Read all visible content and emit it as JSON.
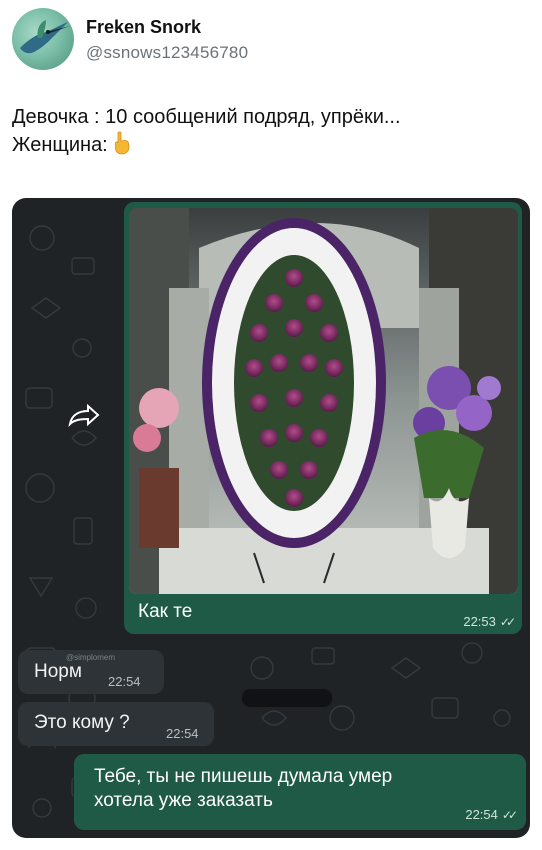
{
  "tweet": {
    "display_name": "Freken Snork",
    "handle": "@ssnows123456780",
    "text_line1": "Девочка : 10 сообщений подряд, упрёки...",
    "text_line2": "Женщина:"
  },
  "chat": {
    "photo_message": {
      "caption": "Как те",
      "time": "22:53",
      "status": "read"
    },
    "incoming": [
      {
        "text": "Норм",
        "time": "22:54"
      },
      {
        "text": "Это кому ?",
        "time": "22:54"
      }
    ],
    "outgoing": {
      "line1": "Тебе, ты не пишешь думала умер",
      "line2": "хотела уже заказать",
      "time": "22:54",
      "status": "read"
    },
    "watermark": "@simplomem"
  },
  "colors": {
    "chat_background": "#1f2326",
    "outgoing_bubble": "#1e5a45",
    "incoming_bubble": "#2d3336"
  }
}
